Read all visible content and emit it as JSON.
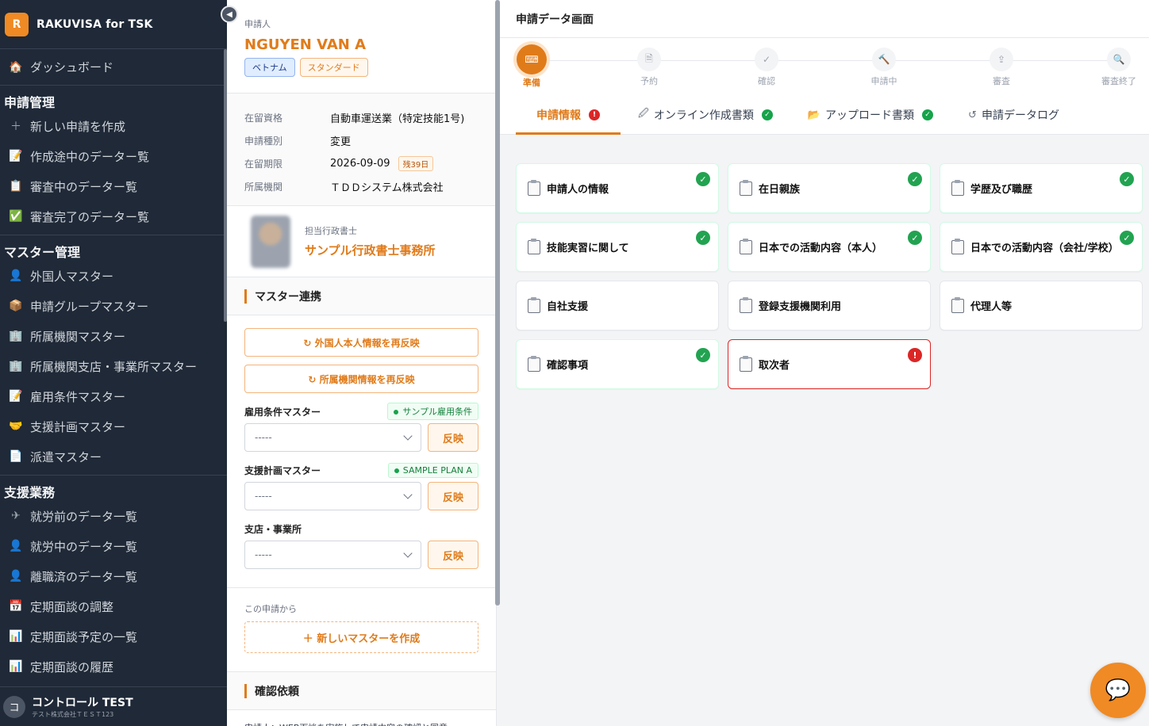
{
  "sidebar": {
    "brand_initial": "R",
    "brand_name": "RAKUVISA for TSK",
    "collapse_glyph": "◀",
    "dashboard": {
      "label": "ダッシュボード",
      "icon": "🏠"
    },
    "sections": [
      {
        "title": "申請管理",
        "items": [
          {
            "label": "新しい申請を作成",
            "icon": "＋"
          },
          {
            "label": "作成途中のデーター覧",
            "icon": "📝"
          },
          {
            "label": "審査中のデーター覧",
            "icon": "📋"
          },
          {
            "label": "審査完了のデーター覧",
            "icon": "✅"
          }
        ]
      },
      {
        "title": "マスター管理",
        "items": [
          {
            "label": "外国人マスター",
            "icon": "👤"
          },
          {
            "label": "申請グループマスター",
            "icon": "📦"
          },
          {
            "label": "所属機関マスター",
            "icon": "🏢"
          },
          {
            "label": "所属機関支店・事業所マスター",
            "icon": "🏢"
          },
          {
            "label": "雇用条件マスター",
            "icon": "📝"
          },
          {
            "label": "支援計画マスター",
            "icon": "🤝"
          },
          {
            "label": "派遣マスター",
            "icon": "📄"
          }
        ]
      },
      {
        "title": "支援業務",
        "items": [
          {
            "label": "就労前のデータ一覧",
            "icon": "✈"
          },
          {
            "label": "就労中のデータ一覧",
            "icon": "👤"
          },
          {
            "label": "離職済のデータ一覧",
            "icon": "👤"
          },
          {
            "label": "定期面談の調整",
            "icon": "📅"
          },
          {
            "label": "定期面談予定の一覧",
            "icon": "📊"
          },
          {
            "label": "定期面談の履歴",
            "icon": "📊"
          }
        ]
      }
    ],
    "user": {
      "initial": "コ",
      "name": "コントロール TEST",
      "org": "テスト株式会社ＴＥＳＴ123"
    }
  },
  "applicant": {
    "label": "申請人",
    "name": "NGUYEN VAN A",
    "tags": [
      "ベトナム",
      "スタンダード"
    ],
    "info": [
      {
        "k": "在留資格",
        "v": "自動車運送業（特定技能1号)"
      },
      {
        "k": "申請種別",
        "v": "変更"
      },
      {
        "k": "在留期限",
        "v": "2026-09-09",
        "badge": "残39日"
      },
      {
        "k": "所属機関",
        "v": "ＴＤＤシステム株式会社"
      }
    ],
    "scrivener_label": "担当行政書士",
    "scrivener_name": "サンプル行政書士事務所"
  },
  "master_sync": {
    "title": "マスター連携",
    "btn_foreigner": "↻ 外国人本人情報を再反映",
    "btn_org": "↻ 所属機関情報を再反映",
    "fields": [
      {
        "label": "雇用条件マスター",
        "pill": "サンプル雇用条件",
        "value": "-----",
        "apply": "反映"
      },
      {
        "label": "支援計画マスター",
        "pill": "SAMPLE PLAN A",
        "value": "-----",
        "apply": "反映"
      },
      {
        "label": "支店・事業所",
        "pill": "",
        "value": "-----",
        "apply": "反映"
      }
    ],
    "from_app_label": "この申請から",
    "new_master_btn": "＋ 新しいマスターを作成"
  },
  "confirm": {
    "title": "確認依頼",
    "text": "申請人：WEB面談を実施して申請内容の確認と同意"
  },
  "main": {
    "title": "申請データ画面",
    "steps": [
      {
        "label": "準備",
        "icon": "⌨",
        "active": true
      },
      {
        "label": "予約",
        "icon": "🗎",
        "active": false
      },
      {
        "label": "確認",
        "icon": "✓",
        "active": false
      },
      {
        "label": "申請中",
        "icon": "🔨",
        "active": false
      },
      {
        "label": "審査",
        "icon": "⇪",
        "active": false
      },
      {
        "label": "審査終了",
        "icon": "🔍",
        "active": false
      }
    ],
    "tabs": [
      {
        "label": "申請情報",
        "icon": "",
        "status": "err",
        "active": true
      },
      {
        "label": "オンライン作成書類",
        "icon": "🖉",
        "status": "ok",
        "active": false
      },
      {
        "label": "アップロード書類",
        "icon": "📂",
        "status": "ok",
        "active": false
      },
      {
        "label": "申請データログ",
        "icon": "↺",
        "status": "",
        "active": false
      }
    ],
    "cards": [
      {
        "label": "申請人の情報",
        "status": "ok"
      },
      {
        "label": "在日親族",
        "status": "ok"
      },
      {
        "label": "学歴及び職歴",
        "status": "ok"
      },
      {
        "label": "技能実習に関して",
        "status": "ok"
      },
      {
        "label": "日本での活動内容（本人）",
        "status": "ok"
      },
      {
        "label": "日本での活動内容（会社/学校）",
        "status": "ok"
      },
      {
        "label": "自社支援",
        "status": ""
      },
      {
        "label": "登録支援機関利用",
        "status": ""
      },
      {
        "label": "代理人等",
        "status": ""
      },
      {
        "label": "確認事項",
        "status": "ok"
      },
      {
        "label": "取次者",
        "status": "err"
      }
    ]
  },
  "chat_icon": "💬"
}
